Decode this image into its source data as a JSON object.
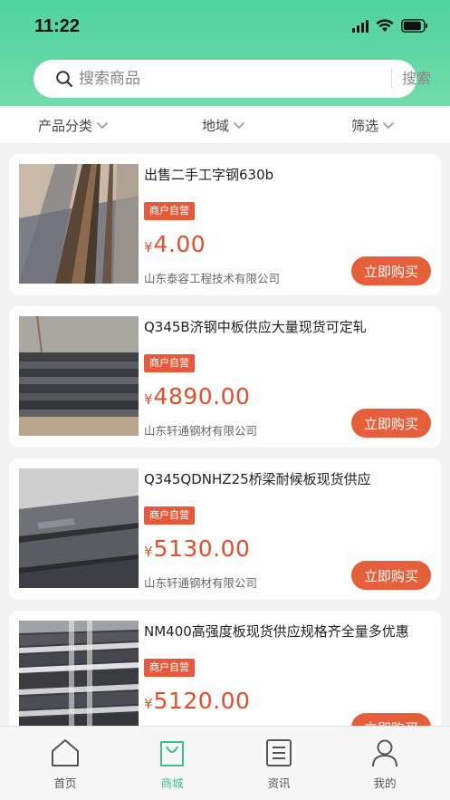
{
  "status_bar": {
    "time": "11:22"
  },
  "search": {
    "placeholder": "搜索商品",
    "button_label": "搜索"
  },
  "filters": {
    "category": "产品分类",
    "region": "地域",
    "filter": "筛选"
  },
  "products": [
    {
      "title": "出售二手工字钢630b",
      "badge": "商户自营",
      "currency": "¥",
      "price": "4.00",
      "company": "山东泰容工程技术有限公司",
      "buy_label": "立即购买"
    },
    {
      "title": "Q345B济钢中板供应大量现货可定轧",
      "badge": "商户自营",
      "currency": "¥",
      "price": "4890.00",
      "company": "山东轩通钢材有限公司",
      "buy_label": "立即购买"
    },
    {
      "title": "Q345QDNHZ25桥梁耐候板现货供应",
      "badge": "商户自营",
      "currency": "¥",
      "price": "5130.00",
      "company": "山东轩通钢材有限公司",
      "buy_label": "立即购买"
    },
    {
      "title": "NM400高强度板现货供应规格齐全量多优惠",
      "badge": "商户自营",
      "currency": "¥",
      "price": "5120.00",
      "company": "",
      "buy_label": "立即购买"
    }
  ],
  "tabs": [
    {
      "label": "首页",
      "icon": "home-icon"
    },
    {
      "label": "商城",
      "icon": "shopping-bag-icon"
    },
    {
      "label": "资讯",
      "icon": "news-icon"
    },
    {
      "label": "我的",
      "icon": "user-icon"
    }
  ],
  "colors": {
    "header": "#5fd6a4",
    "accent": "#e4603b",
    "price": "#e04e2e",
    "tab_active": "#3dbf8c"
  }
}
